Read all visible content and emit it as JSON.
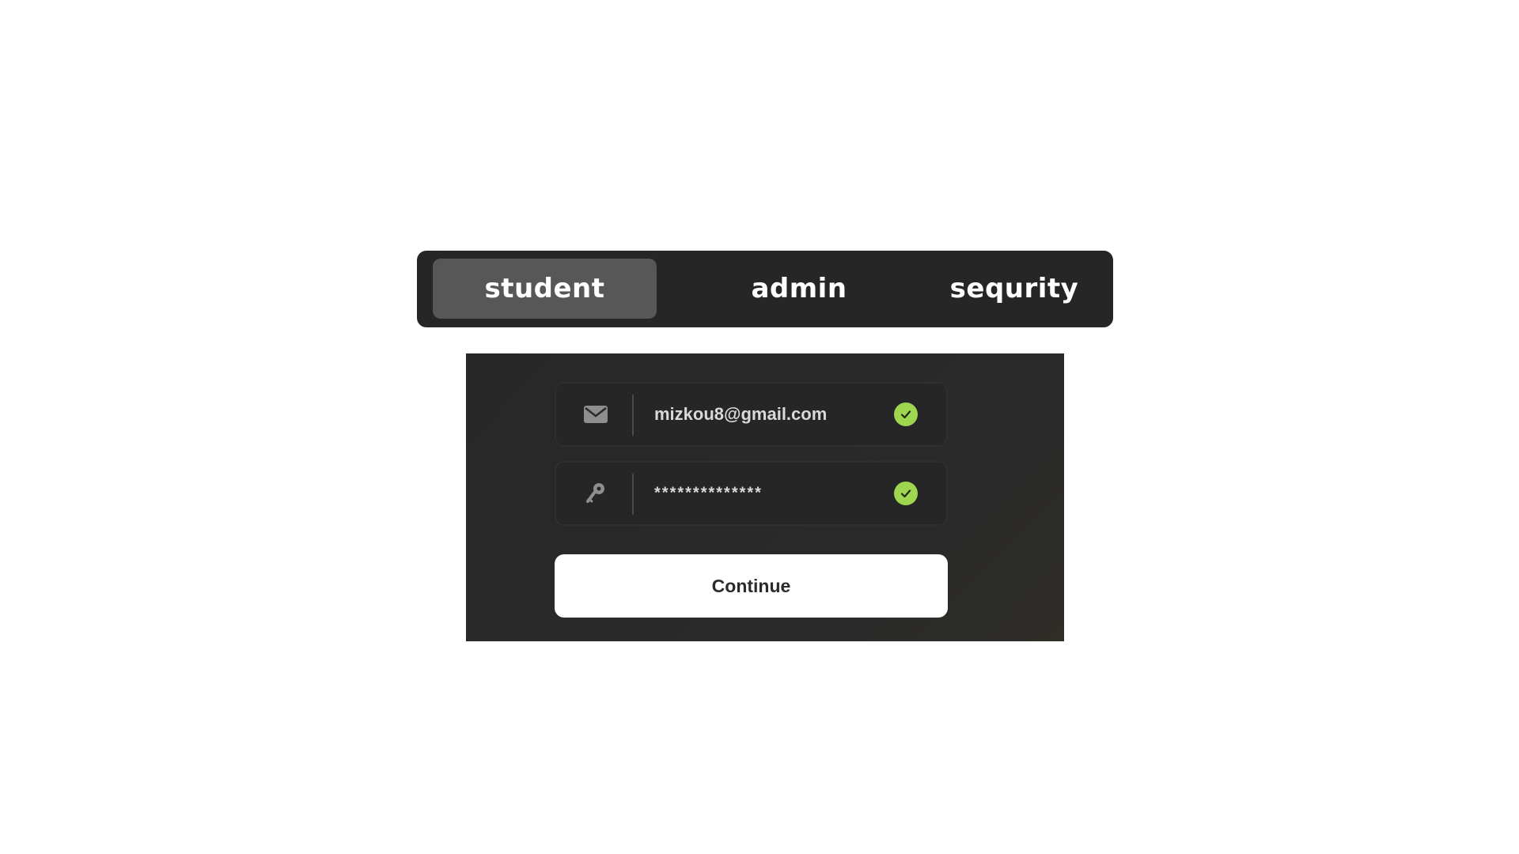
{
  "tabs": [
    {
      "label": "student",
      "active": true
    },
    {
      "label": "admin",
      "active": false
    },
    {
      "label": "sequrity",
      "active": false
    }
  ],
  "login": {
    "email": {
      "value": "mizkou8@gmail.com",
      "icon": "mail-icon",
      "valid": true
    },
    "password": {
      "value": "**************",
      "icon": "key-icon",
      "valid": true
    },
    "continue_label": "Continue"
  },
  "colors": {
    "tabbar_bg": "#262626",
    "tab_active_bg": "#575757",
    "panel_bg": "#292929",
    "check_green": "#9ed64f",
    "button_bg": "#ffffff"
  }
}
